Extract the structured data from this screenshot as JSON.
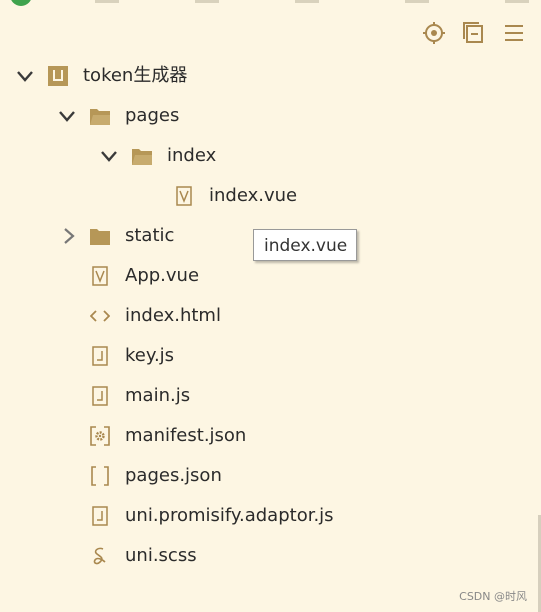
{
  "toolbar": {
    "buttons": [
      {
        "name": "locate-file-icon"
      },
      {
        "name": "collapse-all-icon"
      },
      {
        "name": "menu-icon"
      }
    ]
  },
  "tree": {
    "project": "token生成器",
    "pages": "pages",
    "index_folder": "index",
    "index_vue": "index.vue",
    "static": "static",
    "app_vue": "App.vue",
    "index_html": "index.html",
    "key_js": "key.js",
    "main_js": "main.js",
    "manifest_json": "manifest.json",
    "pages_json": "pages.json",
    "promisify_js": "uni.promisify.adaptor.js",
    "uni_scss": "uni.scss"
  },
  "tooltip": "index.vue",
  "watermark": "CSDN @时风",
  "colors": {
    "background": "#fdf6e3",
    "icon": "#a9884f",
    "chevron": "#3a3a3a"
  }
}
